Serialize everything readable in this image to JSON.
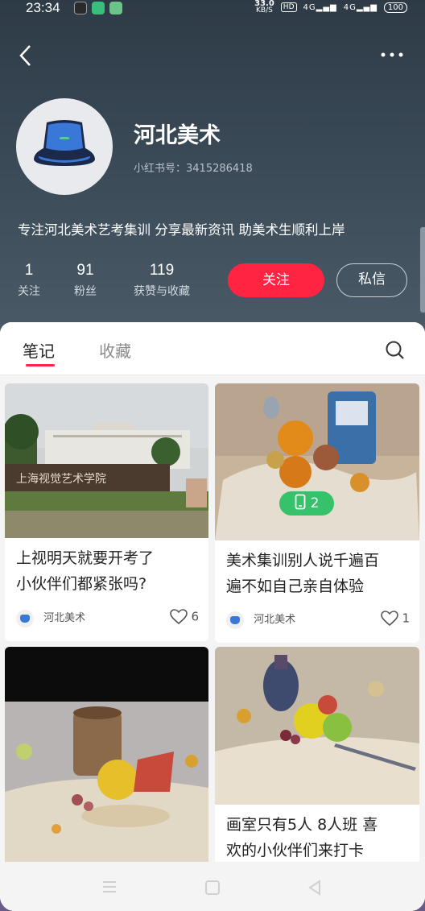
{
  "status_bar": {
    "time": "23:34",
    "speed": "33.0",
    "speed_unit": "KB/S",
    "hd": "HD",
    "net1": "4G",
    "net2": "4G",
    "battery": "100"
  },
  "profile": {
    "name": "河北美术",
    "id_text": "小红书号：3415286418",
    "bio": "专注河北美术艺考集训  分享最新资讯  助美术生顺利上岸",
    "stats": [
      {
        "value": "1",
        "label": "关注"
      },
      {
        "value": "91",
        "label": "粉丝"
      },
      {
        "value": "119",
        "label": "获赞与收藏"
      }
    ],
    "follow_label": "关注",
    "message_label": "私信"
  },
  "tabs": [
    {
      "label": "笔记",
      "active": true
    },
    {
      "label": "收藏",
      "active": false
    }
  ],
  "notes": [
    {
      "title_line1": "上视明天就要开考了",
      "title_line2": "小伙伴们都紧张吗?",
      "author": "河北美术",
      "likes": "6"
    },
    {
      "title_line1": "美术集训别人说千遍百",
      "title_line2": "遍不如自己亲自体验",
      "author": "河北美术",
      "likes": "1",
      "badge": "2"
    },
    {
      "title_line1": "",
      "title_line2": ""
    },
    {
      "title_line1": "画室只有5人 8人班 喜",
      "title_line2": "欢的小伙伴们来打卡"
    }
  ],
  "photo_sign_text": "上海视觉艺术学院",
  "colors": {
    "accent": "#ff2442",
    "header_bg": "#3a4956",
    "badge_green": "#35c26a",
    "avatar_blue": "#3a78d8"
  }
}
